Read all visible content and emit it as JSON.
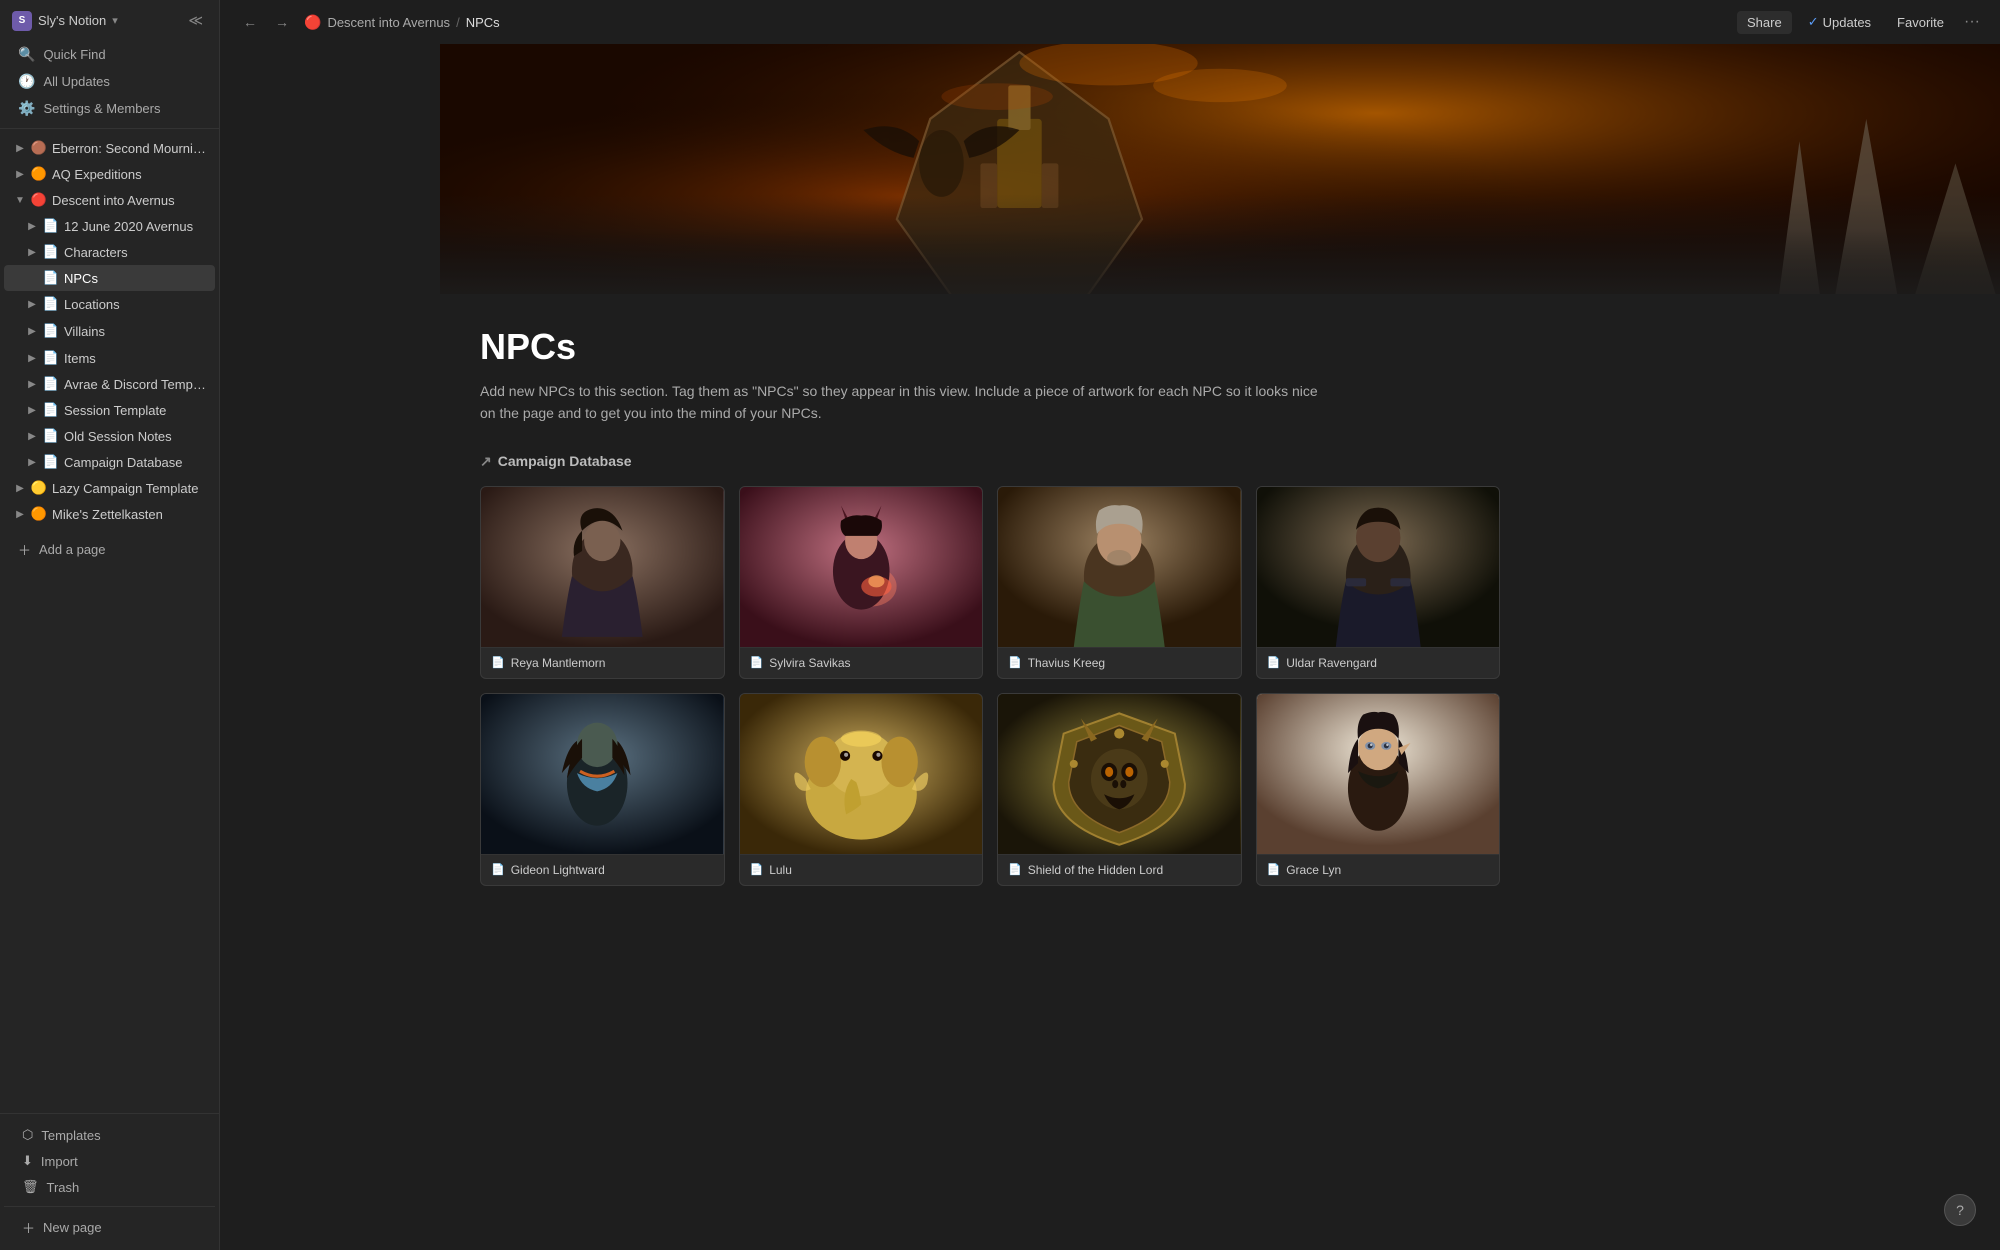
{
  "workspace": {
    "name": "Sly's Notion",
    "dropdown_icon": "▾"
  },
  "topbar": {
    "back_label": "←",
    "forward_label": "→",
    "breadcrumb_parent": "Descent into Avernus",
    "breadcrumb_sep": "/",
    "breadcrumb_current": "NPCs",
    "share_label": "Share",
    "updates_label": "Updates",
    "favorite_label": "Favorite",
    "more_label": "···"
  },
  "sidebar": {
    "quick_find": "Quick Find",
    "all_updates": "All Updates",
    "settings": "Settings & Members",
    "nav_items": [
      {
        "id": "eberron",
        "label": "Eberron: Second Mourning",
        "icon": "🟤",
        "indent": 0,
        "has_toggle": true,
        "expanded": false
      },
      {
        "id": "aq",
        "label": "AQ Expeditions",
        "icon": "🟠",
        "indent": 0,
        "has_toggle": true,
        "expanded": false
      },
      {
        "id": "descent",
        "label": "Descent into Avernus",
        "icon": "🔴",
        "indent": 0,
        "has_toggle": true,
        "expanded": true
      },
      {
        "id": "june2020",
        "label": "12 June 2020 Avernus",
        "icon": "📄",
        "indent": 1,
        "has_toggle": true,
        "expanded": false
      },
      {
        "id": "characters",
        "label": "Characters",
        "icon": "📄",
        "indent": 1,
        "has_toggle": true,
        "expanded": false
      },
      {
        "id": "npcs",
        "label": "NPCs",
        "icon": "📄",
        "indent": 1,
        "has_toggle": false,
        "expanded": false,
        "active": true
      },
      {
        "id": "locations",
        "label": "Locations",
        "icon": "📄",
        "indent": 1,
        "has_toggle": true,
        "expanded": false
      },
      {
        "id": "villains",
        "label": "Villains",
        "icon": "📄",
        "indent": 1,
        "has_toggle": true,
        "expanded": false
      },
      {
        "id": "items",
        "label": "Items",
        "icon": "📄",
        "indent": 1,
        "has_toggle": true,
        "expanded": false
      },
      {
        "id": "avrae",
        "label": "Avrae & Discord Templates",
        "icon": "📄",
        "indent": 1,
        "has_toggle": true,
        "expanded": false
      },
      {
        "id": "session-template",
        "label": "Session Template",
        "icon": "📄",
        "indent": 1,
        "has_toggle": true,
        "expanded": false
      },
      {
        "id": "old-session",
        "label": "Old Session Notes",
        "icon": "📄",
        "indent": 1,
        "has_toggle": true,
        "expanded": false
      },
      {
        "id": "campaign-db",
        "label": "Campaign Database",
        "icon": "📄",
        "indent": 1,
        "has_toggle": true,
        "expanded": false
      },
      {
        "id": "lazy",
        "label": "Lazy Campaign Template",
        "icon": "🟡",
        "indent": 0,
        "has_toggle": true,
        "expanded": false
      },
      {
        "id": "mikes",
        "label": "Mike's Zettelkasten",
        "icon": "🟠",
        "indent": 0,
        "has_toggle": true,
        "expanded": false
      }
    ],
    "add_page": "Add a page",
    "templates": "Templates",
    "import": "Import",
    "trash": "Trash",
    "new_page": "New page"
  },
  "page": {
    "title": "NPCs",
    "description": "Add new NPCs to this section. Tag them as \"NPCs\" so they appear in this view. Include a piece of artwork for each NPC so it looks nice on the page and to get you into the mind of your NPCs.",
    "section_title": "Campaign Database",
    "section_arrow": "↗"
  },
  "npcs": [
    {
      "id": "reya",
      "name": "Reya Mantlemorn",
      "portrait_class": "portrait-reya"
    },
    {
      "id": "sylvira",
      "name": "Sylvira Savikas",
      "portrait_class": "portrait-sylvira"
    },
    {
      "id": "thavius",
      "name": "Thavius Kreeg",
      "portrait_class": "portrait-thavius"
    },
    {
      "id": "uldar",
      "name": "Uldar Ravengard",
      "portrait_class": "portrait-uldar"
    },
    {
      "id": "gideon",
      "name": "Gideon Lightward",
      "portrait_class": "portrait-gideon"
    },
    {
      "id": "lulu",
      "name": "Lulu",
      "portrait_class": "portrait-lulu"
    },
    {
      "id": "shield",
      "name": "Shield of the Hidden Lord",
      "portrait_class": "portrait-shield"
    },
    {
      "id": "grace",
      "name": "Grace Lyn",
      "portrait_class": "portrait-grace"
    }
  ],
  "misc": {
    "help": "?",
    "add_page_label": "+ New page",
    "page_icon": "📄"
  }
}
